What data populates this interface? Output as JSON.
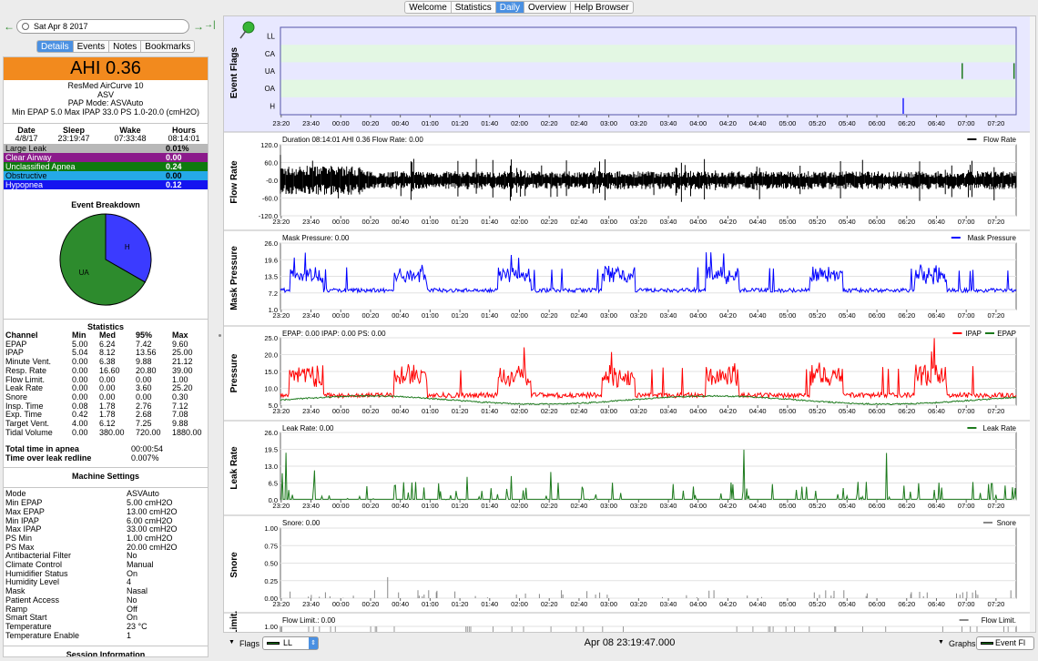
{
  "nav": {
    "tabs": [
      "Welcome",
      "Statistics",
      "Daily",
      "Overview",
      "Help Browser"
    ],
    "active": "Daily"
  },
  "datebar": {
    "date": "Sat Apr 8 2017",
    "prev_icon": "←",
    "next_icon": "→",
    "last_icon": "→|"
  },
  "subtabs": {
    "items": [
      "Details",
      "Events",
      "Notes",
      "Bookmarks"
    ],
    "active": "Details"
  },
  "summary": {
    "ahi": "AHI 0.36",
    "machine": "ResMed AirCurve 10",
    "mode_short": "ASV",
    "pap_mode": "PAP Mode: ASVAuto",
    "pressures": "Min EPAP 5.0 Max IPAP 33.0 PS 1.0-20.0 (cmH2O)"
  },
  "session": {
    "headers": [
      "Date",
      "Sleep",
      "Wake",
      "Hours"
    ],
    "values": [
      "4/8/17",
      "23:19:47",
      "07:33:48",
      "08:14:01"
    ]
  },
  "events": [
    {
      "name": "Large Leak",
      "value": "0.01%",
      "color": "#b8b8b8",
      "text": "#000000"
    },
    {
      "name": "Clear Airway",
      "value": "0.00",
      "color": "#8b1a8b",
      "text": "#ffffff"
    },
    {
      "name": "Unclassified Apnea",
      "value": "0.24",
      "color": "#0f7a0f",
      "text": "#ffffff"
    },
    {
      "name": "Obstructive",
      "value": "0.00",
      "color": "#25a9e8",
      "text": "#000000"
    },
    {
      "name": "Hypopnea",
      "value": "0.12",
      "color": "#1414f0",
      "text": "#ffffff"
    }
  ],
  "breakdown": {
    "title": "Event Breakdown",
    "slices": [
      {
        "label": "H",
        "fraction": 0.333,
        "color": "#3b3bff"
      },
      {
        "label": "UA",
        "fraction": 0.667,
        "color": "#2d8b2d"
      }
    ]
  },
  "statistics": {
    "title": "Statistics",
    "headers": [
      "Channel",
      "Min",
      "Med",
      "95%",
      "Max"
    ],
    "rows": [
      [
        "EPAP",
        "5.00",
        "6.24",
        "7.42",
        "9.60"
      ],
      [
        "IPAP",
        "5.04",
        "8.12",
        "13.56",
        "25.00"
      ],
      [
        "Minute Vent.",
        "0.00",
        "6.38",
        "9.88",
        "21.12"
      ],
      [
        "Resp. Rate",
        "0.00",
        "16.60",
        "20.80",
        "39.00"
      ],
      [
        "Flow Limit.",
        "0.00",
        "0.00",
        "0.00",
        "1.00"
      ],
      [
        "Leak Rate",
        "0.00",
        "0.00",
        "3.60",
        "25.20"
      ],
      [
        "Snore",
        "0.00",
        "0.00",
        "0.00",
        "0.30"
      ],
      [
        "Insp. Time",
        "0.08",
        "1.78",
        "2.76",
        "7.12"
      ],
      [
        "Exp. Time",
        "0.42",
        "1.78",
        "2.68",
        "7.08"
      ],
      [
        "Target Vent.",
        "4.00",
        "6.12",
        "7.25",
        "9.88"
      ],
      [
        "Tidal Volume",
        "0.00",
        "380.00",
        "720.00",
        "1880.00"
      ]
    ]
  },
  "totals": [
    {
      "label": "Total time in apnea",
      "value": "00:00:54"
    },
    {
      "label": "Time over leak redline",
      "value": "0.007%"
    }
  ],
  "machine_settings": {
    "title": "Machine Settings",
    "rows": [
      [
        "Mode",
        "ASVAuto"
      ],
      [
        "Min EPAP",
        "5.00 cmH2O"
      ],
      [
        "Max EPAP",
        "13.00 cmH2O"
      ],
      [
        "Min IPAP",
        "6.00 cmH2O"
      ],
      [
        "Max IPAP",
        "33.00 cmH2O"
      ],
      [
        "PS Min",
        "1.00 cmH2O"
      ],
      [
        "PS Max",
        "20.00 cmH2O"
      ],
      [
        "Antibacterial Filter",
        "No"
      ],
      [
        "Climate Control",
        "Manual"
      ],
      [
        "Humidifier Status",
        "On"
      ],
      [
        "Humidity Level",
        "4"
      ],
      [
        "Mask",
        "Nasal"
      ],
      [
        "Patient Access",
        "No"
      ],
      [
        "Ramp",
        "Off"
      ],
      [
        "Smart Start",
        "On"
      ],
      [
        "Temperature",
        "23 °C"
      ],
      [
        "Temperature Enable",
        "1"
      ]
    ]
  },
  "session_info_title": "Session Information",
  "time_ticks": [
    "23:20",
    "23:40",
    "00:00",
    "00:20",
    "00:40",
    "01:00",
    "01:20",
    "01:40",
    "02:00",
    "02:20",
    "02:40",
    "03:00",
    "03:20",
    "03:40",
    "04:00",
    "04:20",
    "04:40",
    "05:00",
    "05:20",
    "05:40",
    "06:00",
    "06:20",
    "06:40",
    "07:00",
    "07:20"
  ],
  "graphs": [
    {
      "id": "flags",
      "title": "Event Flags",
      "rows": [
        "LL",
        "CA",
        "UA",
        "OA",
        "H"
      ],
      "events": [
        {
          "row": "UA",
          "time": 7.63
        },
        {
          "row": "UA",
          "time": 8.21
        },
        {
          "row": "H",
          "time": 6.97
        }
      ]
    },
    {
      "id": "flow",
      "title": "Flow Rate",
      "header": "Duration 08:14:01 AHI 0.36 Flow Rate: 0.00",
      "legend": "Flow Rate",
      "color": "#000000",
      "yticks": [
        "120.0",
        "60.0",
        "-0.0",
        "-60.0",
        "-120.0"
      ],
      "ylim": [
        -120,
        120
      ]
    },
    {
      "id": "mask",
      "title": "Mask Pressure",
      "header": "Mask Pressure: 0.00",
      "legend": "Mask Pressure",
      "color": "#0000ff",
      "yticks": [
        "26.0",
        "19.6",
        "13.5",
        "7.2",
        "1.0"
      ],
      "ylim": [
        1,
        26
      ]
    },
    {
      "id": "pressure",
      "title": "Pressure",
      "header": "EPAP: 0.00 IPAP: 0.00 PS: 0.00",
      "legend": "IPAP",
      "legend2": "EPAP",
      "color": "#ff0000",
      "color2": "#1d7a1d",
      "yticks": [
        "25.0",
        "20.0",
        "15.0",
        "10.0",
        "5.0"
      ],
      "ylim": [
        5,
        25
      ]
    },
    {
      "id": "leak",
      "title": "Leak Rate",
      "header": "Leak Rate: 0.00",
      "legend": "Leak Rate",
      "color": "#1d7a1d",
      "yticks": [
        "26.0",
        "19.5",
        "13.0",
        "6.5",
        "0.0"
      ],
      "ylim": [
        0,
        26
      ]
    },
    {
      "id": "snore",
      "title": "Snore",
      "header": "Snore: 0.00",
      "legend": "Snore",
      "color": "#888888",
      "yticks": [
        "1.00",
        "0.75",
        "0.50",
        "0.25",
        "0.00"
      ],
      "ylim": [
        0,
        1
      ]
    },
    {
      "id": "flowlimit",
      "title": "Flow Limit.",
      "header": "Flow Limit.: 0.00",
      "legend": "Flow Limit.",
      "color": "#888888",
      "yticks": [
        "1.00"
      ],
      "ylim": [
        0,
        1
      ]
    }
  ],
  "bottombar": {
    "flags_label": "Flags",
    "flags_select": "LL",
    "time": "Apr 08 23:19:47.000",
    "graphs_label": "Graphs",
    "graphs_select": "Event Fl"
  },
  "colors": {
    "accent": "#4a90e2",
    "ahi": "#f28a1e",
    "flag_band": "#e3f7e3",
    "flag_panel": "#e8e8ff"
  }
}
